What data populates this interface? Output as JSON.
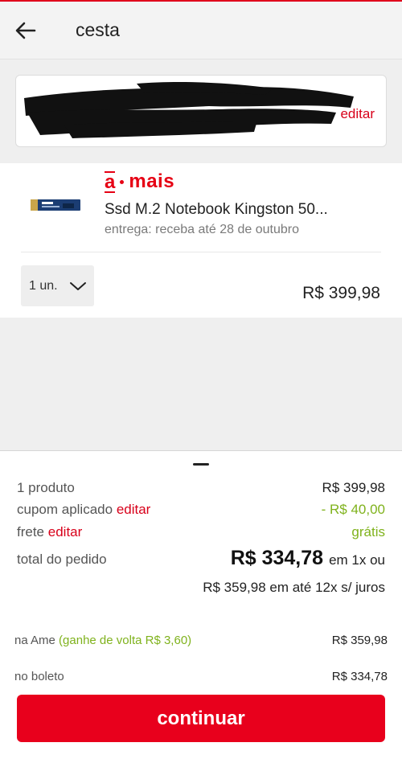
{
  "header": {
    "title": "cesta"
  },
  "address": {
    "edit_label": "editar"
  },
  "product": {
    "seller": {
      "a": "a",
      "rest": "mais"
    },
    "title": "Ssd M.2 Notebook Kingston 50...",
    "delivery": "entrega: receba até 28 de outubro",
    "quantity": "1 un.",
    "price": "R$ 399,98"
  },
  "summary": {
    "items_label": "1 produto",
    "items_value": "R$ 399,98",
    "coupon_label": "cupom aplicado",
    "coupon_edit": "editar",
    "coupon_value": "- R$ 40,00",
    "shipping_label": "frete",
    "shipping_edit": "editar",
    "shipping_value": "grátis",
    "total_label": "total do pedido",
    "total_value": "R$ 334,78",
    "total_suffix": "em 1x ou",
    "installments": "R$ 359,98 em até 12x s/ juros"
  },
  "payment": {
    "ame_label": "na Ame",
    "ame_cashback": "(ganhe de volta R$ 3,60)",
    "ame_value": "R$ 359,98",
    "boleto_label": "no boleto",
    "boleto_value": "R$ 334,78"
  },
  "cta": {
    "continue_label": "continuar"
  },
  "colors": {
    "brand_red": "#e8001c",
    "green": "#7fb21c"
  },
  "icons": {
    "back": "back-arrow-icon",
    "chevron": "chevron-down-icon"
  }
}
